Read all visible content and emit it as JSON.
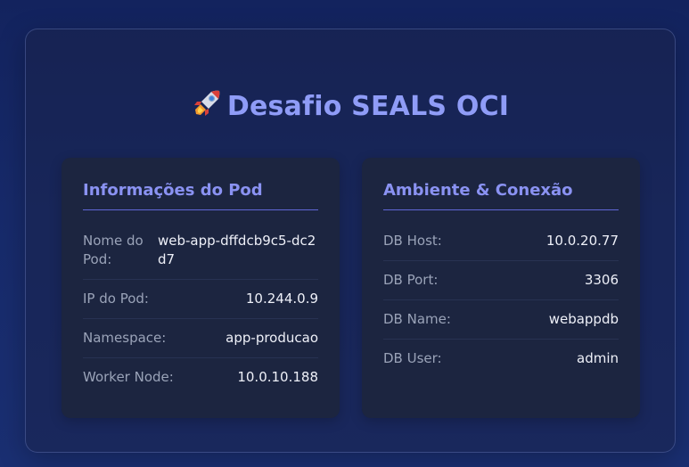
{
  "header": {
    "title": "Desafio SEALS OCI",
    "icon": "rocket-icon"
  },
  "pod_card": {
    "title": "Informações do Pod",
    "rows": [
      {
        "label": "Nome do Pod:",
        "value": "web-app-dffdcb9c5-dc2d7"
      },
      {
        "label": "IP do Pod:",
        "value": "10.244.0.9"
      },
      {
        "label": "Namespace:",
        "value": "app-producao"
      },
      {
        "label": "Worker Node:",
        "value": "10.0.10.188"
      }
    ]
  },
  "env_card": {
    "title": "Ambiente & Conexão",
    "rows": [
      {
        "label": "DB Host:",
        "value": "10.0.20.77"
      },
      {
        "label": "DB Port:",
        "value": "3306"
      },
      {
        "label": "DB Name:",
        "value": "webappdb"
      },
      {
        "label": "DB User:",
        "value": "admin"
      }
    ]
  },
  "colors": {
    "accent": "#8f9cf7",
    "card_background": "#1c2540",
    "page_background": "#172a6a"
  }
}
